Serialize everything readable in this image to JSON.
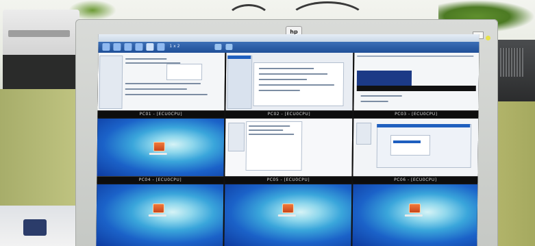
{
  "monitor": {
    "brand_logo_text": "hp"
  },
  "app_window": {
    "toolbar_text": "1 x 2"
  },
  "panes": [
    {
      "id": 1,
      "label": "PC01 - [ECU0CPU]",
      "content": "app"
    },
    {
      "id": 2,
      "label": "PC02 - [ECU0CPU]",
      "content": "app"
    },
    {
      "id": 3,
      "label": "PC03 - [ECU0CPU]",
      "content": "app"
    },
    {
      "id": 4,
      "label": "PC04 - [ECU0CPU]",
      "content": "desktop"
    },
    {
      "id": 5,
      "label": "PC05 - [ECU0CPU]",
      "content": "app"
    },
    {
      "id": 6,
      "label": "PC06 - [ECU0CPU]",
      "content": "app"
    },
    {
      "id": 7,
      "label": "",
      "content": "desktop"
    },
    {
      "id": 8,
      "label": "",
      "content": "desktop"
    },
    {
      "id": 9,
      "label": "",
      "content": "desktop"
    }
  ],
  "colors": {
    "desktop_blue": "#1b62c8",
    "toolbar_blue": "#1f4f98",
    "bezel_silver": "#d9dbd8"
  }
}
